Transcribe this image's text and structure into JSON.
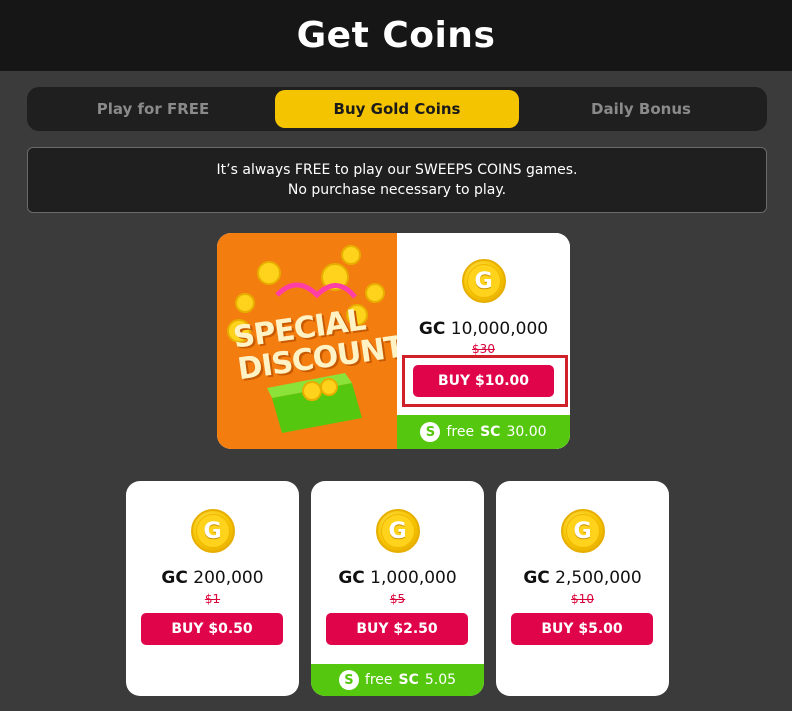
{
  "header": {
    "title": "Get Coins"
  },
  "tabs": [
    {
      "label": "Play for FREE",
      "active": false
    },
    {
      "label": "Buy Gold Coins",
      "active": true
    },
    {
      "label": "Daily Bonus",
      "active": false
    }
  ],
  "notice": {
    "line1": "It’s always FREE to play our SWEEPS COINS games.",
    "line2": "No purchase necessary to play."
  },
  "special_offer": {
    "promo_line1": "SPECIAL",
    "promo_line2": "DISCOUNT",
    "gc_prefix": "GC",
    "gc_amount": "10,000,000",
    "old_price": "$30",
    "buy_label": "BUY $10.00",
    "free_prefix": "free",
    "sc_prefix": "SC",
    "sc_amount": "30.00"
  },
  "packages": [
    {
      "gc_prefix": "GC",
      "gc_amount": "200,000",
      "old_price": "$1",
      "buy_label": "BUY $0.50"
    },
    {
      "gc_prefix": "GC",
      "gc_amount": "1,000,000",
      "old_price": "$5",
      "buy_label": "BUY $2.50",
      "free_prefix": "free",
      "sc_prefix": "SC",
      "sc_amount": "5.05"
    },
    {
      "gc_prefix": "GC",
      "gc_amount": "2,500,000",
      "old_price": "$10",
      "buy_label": "BUY $5.00"
    }
  ],
  "icons": {
    "coin": "gold-coin-icon",
    "sc": "sweeps-coin-icon",
    "coin_letter": "G",
    "sc_letter": "S"
  },
  "colors": {
    "accent": "#f5c400",
    "buy": "#e0054a",
    "free": "#55c70e",
    "promo": "#f47d10"
  }
}
